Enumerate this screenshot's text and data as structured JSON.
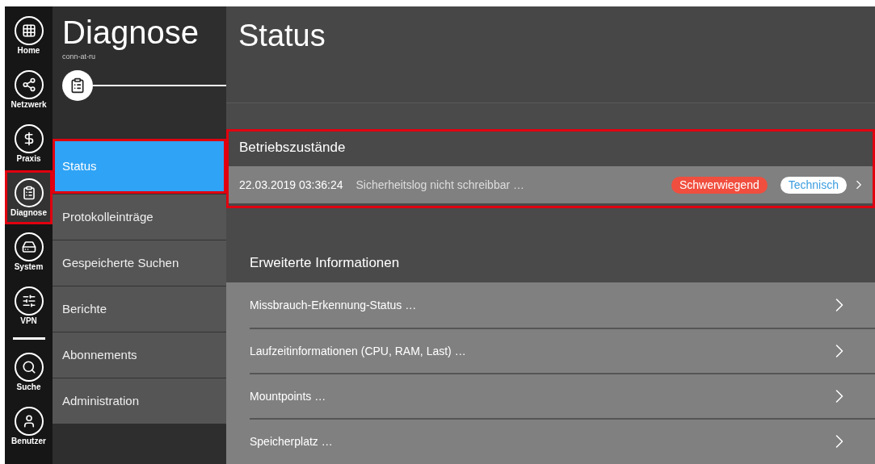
{
  "rail": [
    {
      "label": "Home",
      "selected": false,
      "highlighted": false
    },
    {
      "label": "Netzwerk",
      "selected": false,
      "highlighted": false
    },
    {
      "label": "Praxis",
      "selected": false,
      "highlighted": false
    },
    {
      "label": "Diagnose",
      "selected": true,
      "highlighted": true
    },
    {
      "label": "System",
      "selected": false,
      "highlighted": false
    },
    {
      "label": "VPN",
      "selected": false,
      "highlighted": false
    },
    {
      "label": "Suche",
      "selected": false,
      "highlighted": false
    },
    {
      "label": "Benutzer",
      "selected": false,
      "highlighted": false
    }
  ],
  "section": {
    "title": "Diagnose",
    "subtitle": "conn-at-ru"
  },
  "menu": [
    {
      "label": "Status",
      "selected": true,
      "highlighted": true
    },
    {
      "label": "Protokolleinträge",
      "selected": false,
      "highlighted": false
    },
    {
      "label": "Gespeicherte Suchen",
      "selected": false,
      "highlighted": false
    },
    {
      "label": "Berichte",
      "selected": false,
      "highlighted": false
    },
    {
      "label": "Abonnements",
      "selected": false,
      "highlighted": false
    },
    {
      "label": "Administration",
      "selected": false,
      "highlighted": false
    }
  ],
  "page_title": "Status",
  "operating_states": {
    "title": "Betriebszustände",
    "highlighted": true,
    "rows": [
      {
        "time": "22.03.2019 03:36:24",
        "message": "Sicherheitslog nicht schreibbar …",
        "tags": [
          {
            "label": "Schwerwiegend",
            "kind": "severity"
          },
          {
            "label": "Technisch",
            "kind": "category"
          }
        ]
      }
    ]
  },
  "extended_info": {
    "title": "Erweiterte Informationen",
    "rows": [
      "Missbrauch-Erkennung-Status …",
      "Laufzeitinformationen (CPU, RAM, Last) …",
      "Mountpoints …",
      "Speicherplatz …"
    ]
  }
}
